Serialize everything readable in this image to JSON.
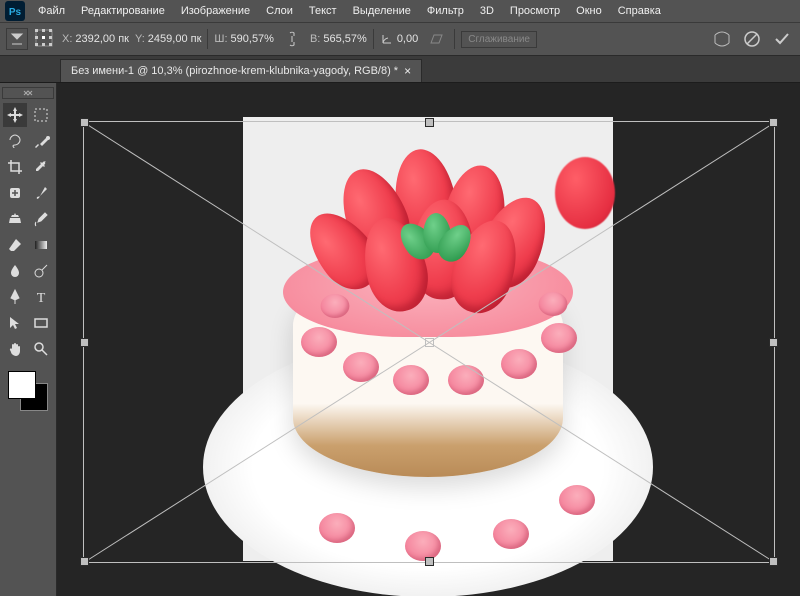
{
  "menu": {
    "file": "Файл",
    "edit": "Редактирование",
    "image": "Изображение",
    "layer": "Слои",
    "text": "Текст",
    "select": "Выделение",
    "filter": "Фильтр",
    "threeD": "3D",
    "view": "Просмотр",
    "window": "Окно",
    "help": "Справка"
  },
  "options": {
    "x_label": "X:",
    "x_value": "2392,00 пк",
    "y_label": "Y:",
    "y_value": "2459,00 пк",
    "w_label": "Ш:",
    "w_value": "590,57%",
    "h_label": "В:",
    "h_value": "565,57%",
    "angle_label": "∠",
    "angle_value": "0,00",
    "interp": "Сглаживание"
  },
  "doc": {
    "title": "Без имени-1 @ 10,3% (pirozhnoe-krem-klubnika-yagody, RGB/8) *"
  },
  "tools": {
    "move": "move-tool",
    "marquee": "rectangular-marquee-tool",
    "lasso": "lasso-tool",
    "quickselect": "quick-selection-tool",
    "crop": "crop-tool",
    "eyedropper": "eyedropper-tool",
    "heal": "spot-heal-tool",
    "brush": "brush-tool",
    "stamp": "clone-stamp-tool",
    "history": "history-brush-tool",
    "eraser": "eraser-tool",
    "gradient": "gradient-tool",
    "blur": "blur-tool",
    "dodge": "dodge-tool",
    "pen": "pen-tool",
    "type": "type-tool",
    "path": "path-selection-tool",
    "shape": "rectangle-tool",
    "hand": "hand-tool",
    "zoom": "zoom-tool"
  }
}
